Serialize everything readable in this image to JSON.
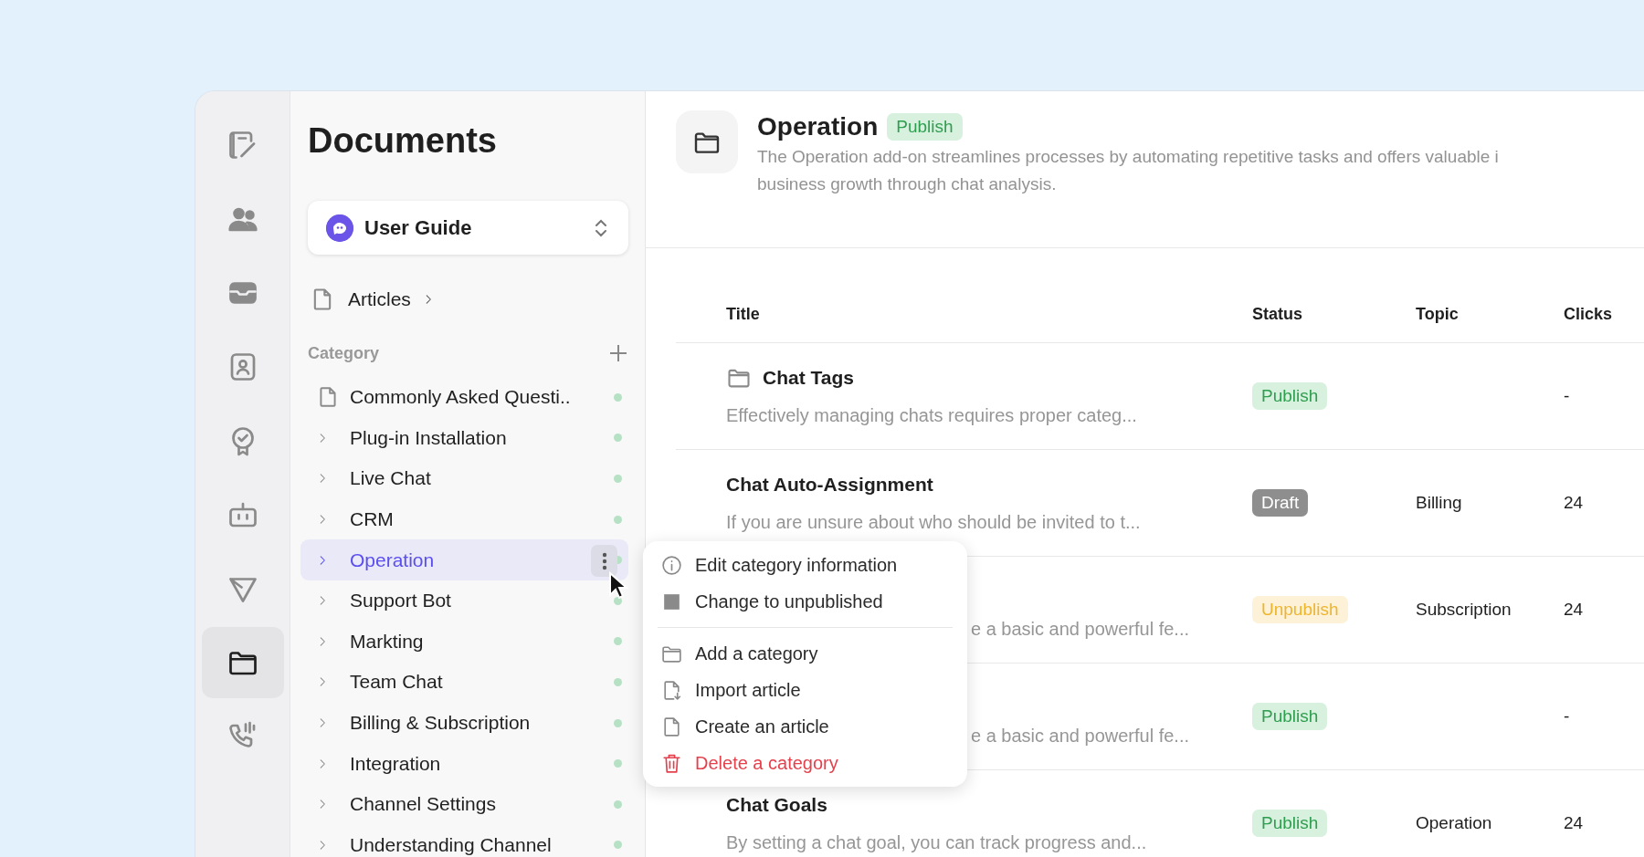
{
  "rail": {
    "items": [
      {
        "selected": false
      },
      {
        "selected": false
      },
      {
        "selected": false
      },
      {
        "selected": false
      },
      {
        "selected": false
      },
      {
        "selected": false
      },
      {
        "selected": false
      },
      {
        "selected": true
      },
      {
        "selected": false
      }
    ]
  },
  "sidebar": {
    "title": "Documents",
    "space_switcher": {
      "label": "User Guide"
    },
    "articles_link": {
      "label": "Articles"
    },
    "category_header": "Category",
    "categories": [
      {
        "label": "Commonly Asked Questi..",
        "kind": "document",
        "selected": false,
        "published": true
      },
      {
        "label": "Plug-in Installation",
        "kind": "folder",
        "selected": false,
        "published": true
      },
      {
        "label": "Live Chat",
        "kind": "folder",
        "selected": false,
        "published": true
      },
      {
        "label": "CRM",
        "kind": "folder",
        "selected": false,
        "published": true
      },
      {
        "label": "Operation",
        "kind": "folder",
        "selected": true,
        "published": true
      },
      {
        "label": "Support Bot",
        "kind": "folder",
        "selected": false,
        "published": true
      },
      {
        "label": "Markting",
        "kind": "folder",
        "selected": false,
        "published": true
      },
      {
        "label": "Team Chat",
        "kind": "folder",
        "selected": false,
        "published": true
      },
      {
        "label": "Billing & Subscription",
        "kind": "folder",
        "selected": false,
        "published": true
      },
      {
        "label": "Integration",
        "kind": "folder",
        "selected": false,
        "published": true
      },
      {
        "label": "Channel Settings",
        "kind": "folder",
        "selected": false,
        "published": true
      },
      {
        "label": "Understanding Channel",
        "kind": "folder",
        "selected": false,
        "published": true
      }
    ]
  },
  "header": {
    "title": "Operation",
    "badge": "Publish",
    "description_lines": [
      "The Operation add-on streamlines processes by automating repetitive tasks and offers valuable i",
      "business growth through chat analysis."
    ]
  },
  "table": {
    "columns": [
      "Title",
      "Status",
      "Topic",
      "Clicks"
    ],
    "rows": [
      {
        "kind": "category",
        "title": "Chat Tags",
        "description": "Effectively managing chats requires proper categ...",
        "status": {
          "label": "Publish",
          "kind": "publish"
        },
        "clicks": "-"
      },
      {
        "kind": "article",
        "title": "Chat Auto-Assignment",
        "description": "If you are unsure about who should be invited to t...",
        "status": {
          "label": "Draft",
          "kind": "draft"
        },
        "topic": "Billing",
        "clicks": "24"
      },
      {
        "kind": "covered",
        "description": "e a basic and powerful fe...",
        "status": {
          "label": "Unpublish",
          "kind": "unpublish"
        },
        "topic": "Subscription",
        "clicks": "24"
      },
      {
        "kind": "covered",
        "description": "e a basic and powerful fe...",
        "status": {
          "label": "Publish",
          "kind": "publish"
        },
        "clicks": "-"
      },
      {
        "kind": "article",
        "title": "Chat Goals",
        "description": "By setting a chat goal, you can track progress and...",
        "status": {
          "label": "Publish",
          "kind": "publish"
        },
        "topic": "Operation",
        "clicks": "24"
      }
    ]
  },
  "context_menu": {
    "groups": [
      [
        {
          "label": "Edit category information",
          "kind": "normal"
        },
        {
          "label": "Change to unpublished",
          "kind": "normal"
        }
      ],
      [
        {
          "label": "Add a category",
          "kind": "normal"
        },
        {
          "label": "Import article",
          "kind": "normal"
        },
        {
          "label": "Create an article",
          "kind": "normal"
        },
        {
          "label": "Delete a category",
          "kind": "danger"
        }
      ]
    ]
  }
}
